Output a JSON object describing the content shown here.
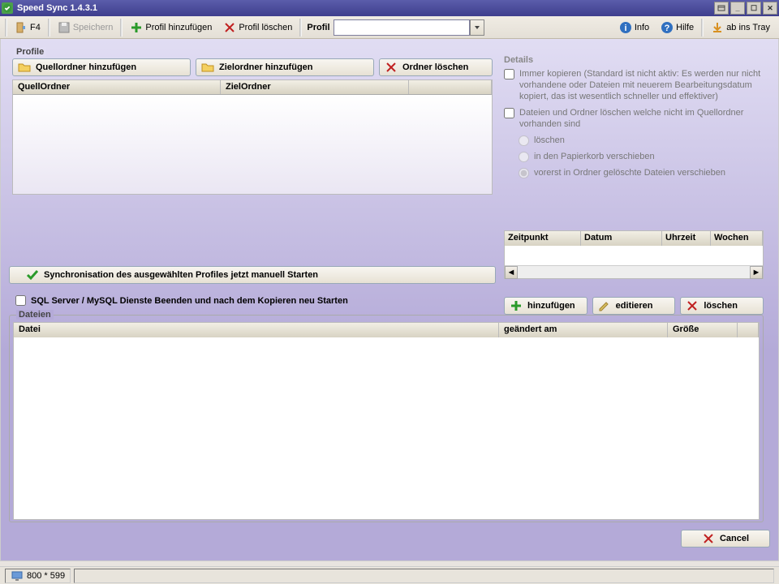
{
  "window": {
    "title": "Speed Sync 1.4.3.1"
  },
  "toolbar": {
    "f4": "F4",
    "save": "Speichern",
    "add_profile": "Profil hinzufügen",
    "delete_profile": "Profil löschen",
    "profile_label": "Profil",
    "info": "Info",
    "help": "Hilfe",
    "tray": "ab ins Tray"
  },
  "profile": {
    "frame": "Profile",
    "add_source": "Quellordner hinzufügen",
    "add_target": "Zielordner hinzufügen",
    "delete_folder": "Ordner löschen",
    "col_source": "QuellOrdner",
    "col_target": "ZielOrdner"
  },
  "details": {
    "title": "Details",
    "always_copy": "Immer kopieren (Standard ist nicht aktiv: Es werden nur nicht vorhandene oder Dateien mit neuerem Bearbeitungsdatum kopiert, das ist wesentlich schneller und effektiver)",
    "delete_missing": "Dateien und Ordner löschen welche nicht im Quellordner vorhanden sind",
    "opt_delete": "löschen",
    "opt_recycle": "in den Papierkorb verschieben",
    "opt_move": "vorerst in Ordner gelöschte Dateien verschieben"
  },
  "schedule": {
    "col_time": "Zeitpunkt",
    "col_date": "Datum",
    "col_clock": "Uhrzeit",
    "col_week": "Wochen",
    "add": "hinzufügen",
    "edit": "editieren",
    "delete": "löschen"
  },
  "sync_now": "Synchronisation des ausgewählten Profiles jetzt manuell Starten",
  "sql_restart": "SQL Server / MySQL Dienste Beenden und nach dem Kopieren neu Starten",
  "files": {
    "frame": "Dateien",
    "col_file": "Datei",
    "col_changed": "geändert am",
    "col_size": "Größe"
  },
  "cancel": "Cancel",
  "status": {
    "dims": "800 * 599"
  }
}
